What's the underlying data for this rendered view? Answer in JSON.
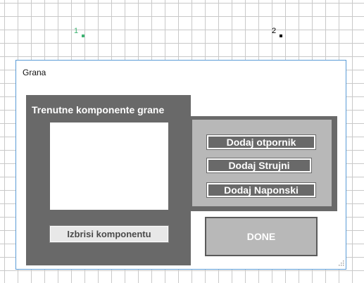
{
  "canvas": {
    "nodes": [
      {
        "label": "1",
        "color": "#3cb371"
      },
      {
        "label": "2",
        "color": "#000000"
      }
    ]
  },
  "dialog": {
    "title": "Grana",
    "components_heading": "Trenutne komponente grane",
    "delete_label": "Izbrisi komponentu",
    "add_resistor_label": "Dodaj otpornik",
    "add_current_label": "Dodaj Strujni",
    "add_voltage_label": "Dodaj Naponski",
    "done_label": "DONE",
    "resize_grip_icon": "resize-grip-icon"
  },
  "colors": {
    "panel_dark": "#696969",
    "panel_light": "#b8b8b8",
    "dialog_border": "#5a9bd6",
    "grid_line": "#c9c9c9"
  }
}
